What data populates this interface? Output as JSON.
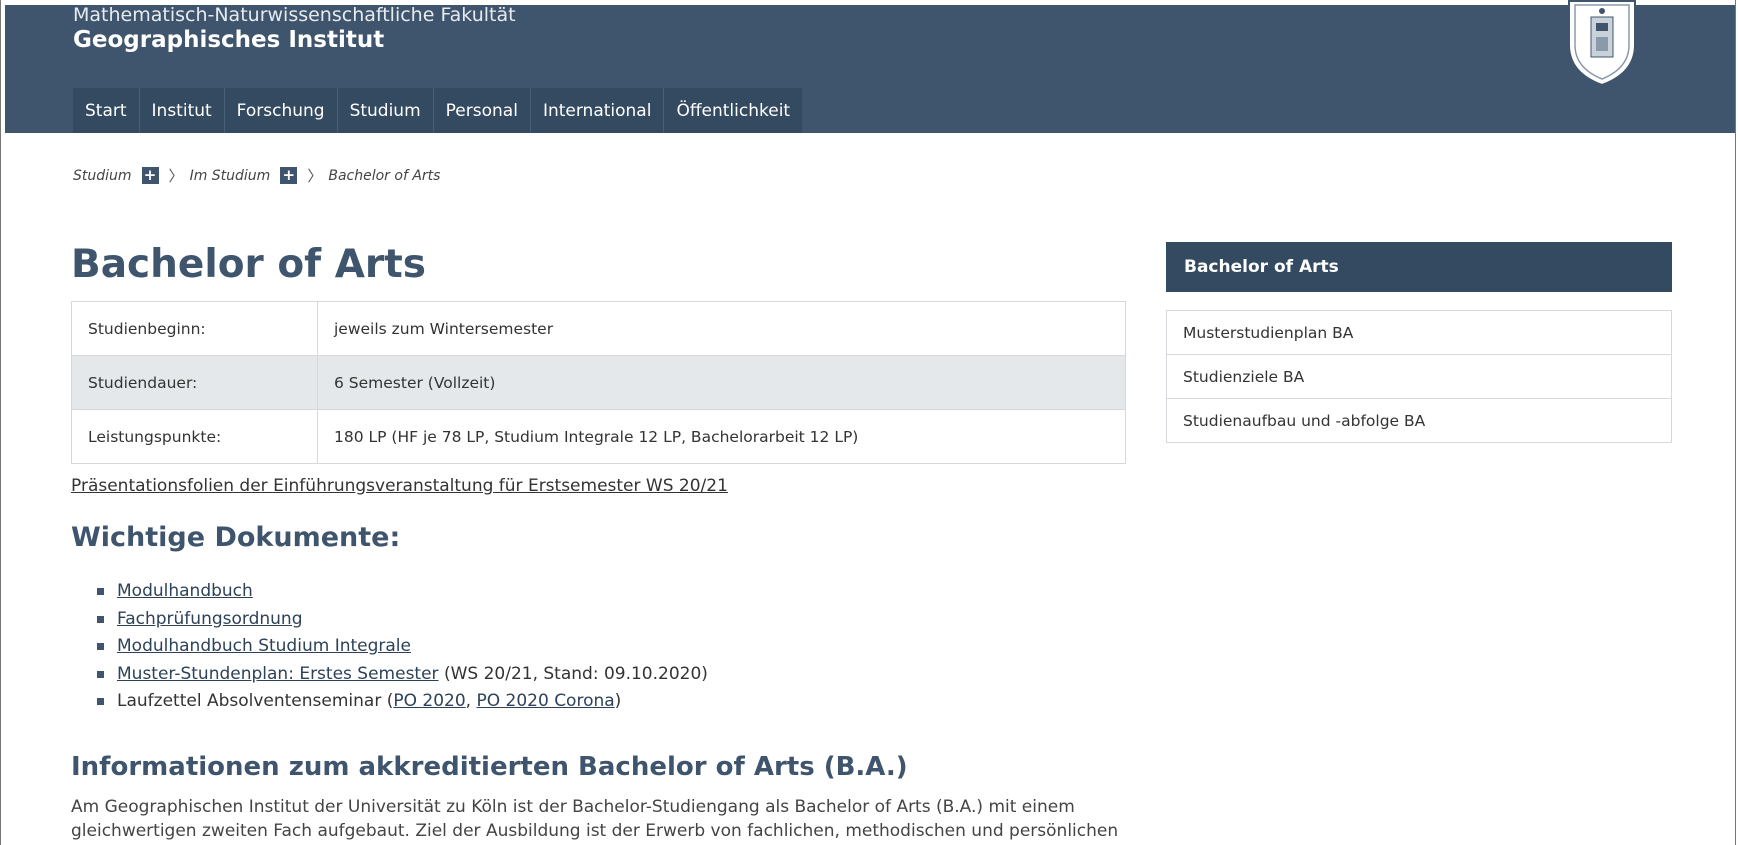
{
  "header": {
    "faculty": "Mathematisch-Naturwissenschaftliche Fakultät",
    "institute": "Geographisches Institut",
    "nav": [
      "Start",
      "Institut",
      "Forschung",
      "Studium",
      "Personal",
      "International",
      "Öffentlichkeit"
    ]
  },
  "breadcrumb": {
    "items": [
      "Studium",
      "Im Studium",
      "Bachelor of Arts"
    ],
    "plus": "+",
    "sep": "〉"
  },
  "main": {
    "title": "Bachelor of Arts",
    "table": [
      {
        "label": "Studienbeginn:",
        "value": "jeweils zum Wintersemester"
      },
      {
        "label": "Studiendauer:",
        "value": "6 Semester (Vollzeit)"
      },
      {
        "label": "Leistungspunkte:",
        "value": "180 LP (HF je 78 LP, Studium Integrale 12 LP, Bachelorarbeit 12 LP)"
      }
    ],
    "presentation_link": "Präsentationsfolien der Einführungsveranstaltung für Erstsemester WS 20/21",
    "documents_heading": "Wichtige Dokumente:",
    "documents": {
      "modulhandbuch": "Modulhandbuch",
      "fachpruefungsordnung": "Fachprüfungsordnung",
      "modulhandbuch_si": "Modulhandbuch Studium Integrale",
      "musterplan_link": "Muster-Stundenplan: Erstes Semester",
      "musterplan_note": " (WS 20/21, Stand: 09.10.2020)",
      "laufzettel_prefix": "Laufzettel Absolventenseminar (",
      "po2020": "PO 2020",
      "comma": ", ",
      "po2020_corona": "PO 2020 Corona",
      "laufzettel_suffix": ")"
    },
    "info_heading": "Informationen zum akkreditierten Bachelor of Arts (B.A.)",
    "info_text": "Am Geographischen Institut der Universität zu Köln ist der Bachelor-Studiengang als Bachelor of Arts (B.A.) mit einem gleichwertigen zweiten Fach aufgebaut. Ziel der Ausbildung ist der Erwerb von fachlichen, methodischen und persönlichen"
  },
  "sidebar": {
    "title": "Bachelor of Arts",
    "items": [
      "Musterstudienplan BA",
      "Studienziele BA",
      "Studienaufbau und -abfolge BA"
    ]
  },
  "colors": {
    "header_bg": "#3f556d",
    "nav_bg": "#334a61",
    "accent": "#3f556d"
  },
  "icons": [
    "university-seal-icon",
    "plus-icon",
    "chevron-right-icon",
    "bullet-square-icon"
  ]
}
